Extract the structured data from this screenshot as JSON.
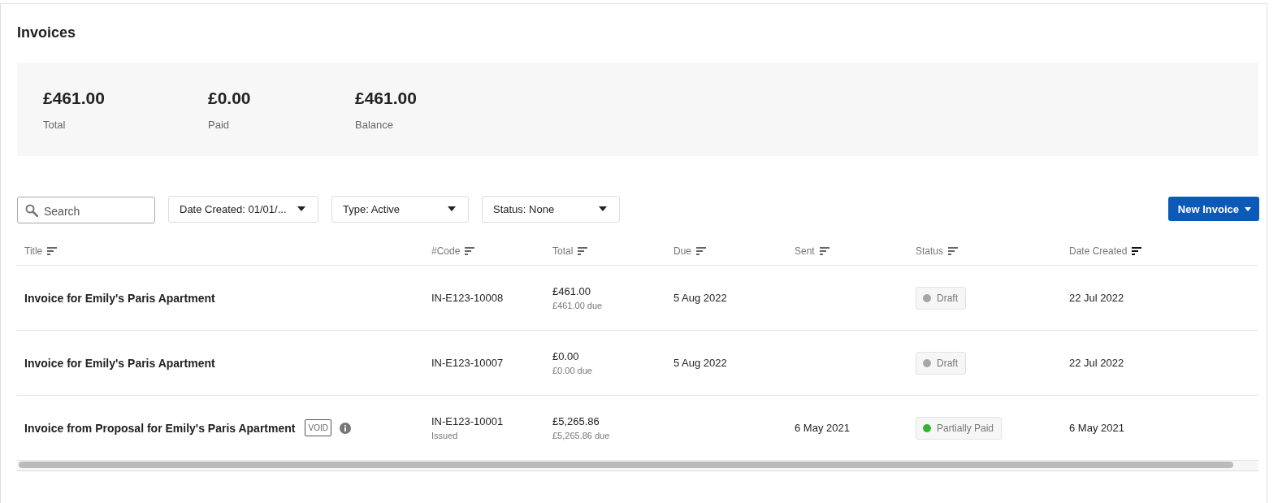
{
  "page_title": "Invoices",
  "summary": [
    {
      "amount": "£461.00",
      "label": "Total"
    },
    {
      "amount": "£0.00",
      "label": "Paid"
    },
    {
      "amount": "£461.00",
      "label": "Balance"
    }
  ],
  "search": {
    "placeholder": "Search"
  },
  "filters": [
    {
      "label": "Date Created: 01/01/..."
    },
    {
      "label": "Type: Active"
    },
    {
      "label": "Status: None"
    }
  ],
  "new_button": {
    "label": "New Invoice"
  },
  "table": {
    "columns": [
      {
        "label": "Title",
        "sorted": false
      },
      {
        "label": "#Code",
        "sorted": false
      },
      {
        "label": "Total",
        "sorted": false
      },
      {
        "label": "Due",
        "sorted": false
      },
      {
        "label": "Sent",
        "sorted": false
      },
      {
        "label": "Status",
        "sorted": false
      },
      {
        "label": "Date Created",
        "sorted": true
      }
    ],
    "rows": [
      {
        "title": "Invoice for Emily's Paris Apartment",
        "void": false,
        "code": "IN-E123-10008",
        "code_note": "",
        "total": "£461.00",
        "total_due": "£461.00 due",
        "due": "5 Aug 2022",
        "sent": "",
        "status": {
          "label": "Draft",
          "color": "#a6a6a6"
        },
        "created": "22 Jul 2022"
      },
      {
        "title": "Invoice for Emily's Paris Apartment",
        "void": false,
        "code": "IN-E123-10007",
        "code_note": "",
        "total": "£0.00",
        "total_due": "£0.00 due",
        "due": "5 Aug 2022",
        "sent": "",
        "status": {
          "label": "Draft",
          "color": "#a6a6a6"
        },
        "created": "22 Jul 2022"
      },
      {
        "title": "Invoice from Proposal for Emily's Paris Apartment",
        "void": true,
        "void_label": "VOID",
        "code": "IN-E123-10001",
        "code_note": "Issued",
        "total": "£5,265.86",
        "total_due": "£5,265.86 due",
        "due": "",
        "sent": "6 May 2021",
        "status": {
          "label": "Partially Paid",
          "color": "#2fb52f"
        },
        "created": "6 May 2021"
      }
    ]
  }
}
